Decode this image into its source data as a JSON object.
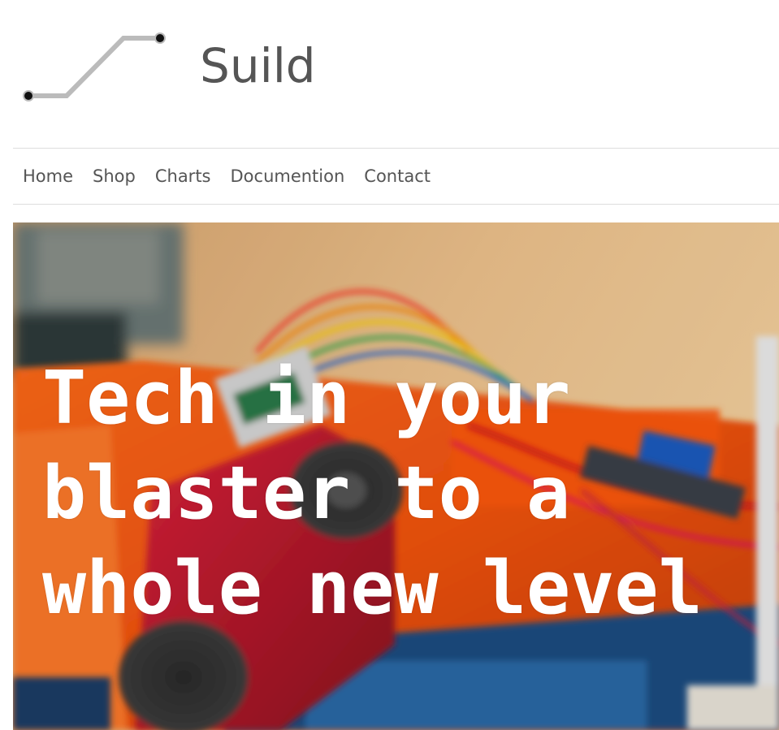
{
  "site": {
    "title": "Suild",
    "logo_icon": "circuit-trace-logo"
  },
  "nav": {
    "items": [
      {
        "label": "Home"
      },
      {
        "label": "Shop"
      },
      {
        "label": "Charts"
      },
      {
        "label": "Documention"
      },
      {
        "label": "Contact"
      }
    ]
  },
  "hero": {
    "headline": "Tech in your blaster to a whole new level",
    "image": "blurred-photo-orange-blaster-electronics-wires"
  },
  "colors": {
    "text": "#555555",
    "logo_line": "#bbbbbb",
    "divider": "#dddddd",
    "hero_text": "#ffffff"
  }
}
